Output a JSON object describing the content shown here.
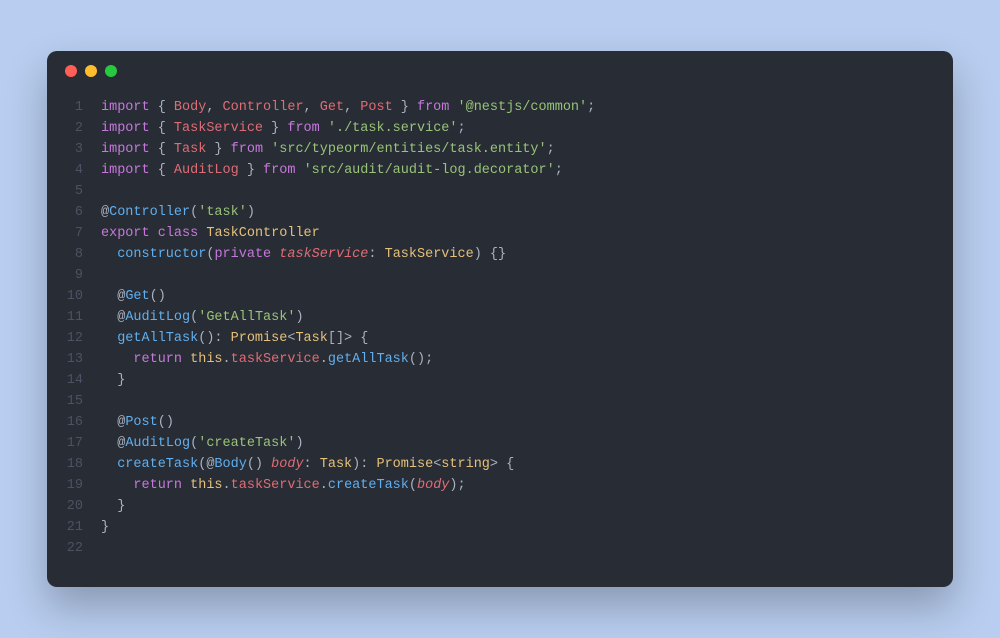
{
  "window": {
    "dot_red": "#ff5f56",
    "dot_yellow": "#ffbd2e",
    "dot_green": "#27c93f"
  },
  "lines": [
    {
      "no": "1",
      "tokens": [
        {
          "c": "tok-keyword",
          "t": "import"
        },
        {
          "c": "tok-punct",
          "t": " { "
        },
        {
          "c": "tok-var",
          "t": "Body"
        },
        {
          "c": "tok-punct",
          "t": ", "
        },
        {
          "c": "tok-var",
          "t": "Controller"
        },
        {
          "c": "tok-punct",
          "t": ", "
        },
        {
          "c": "tok-var",
          "t": "Get"
        },
        {
          "c": "tok-punct",
          "t": ", "
        },
        {
          "c": "tok-var",
          "t": "Post"
        },
        {
          "c": "tok-punct",
          "t": " } "
        },
        {
          "c": "tok-keyword",
          "t": "from"
        },
        {
          "c": "tok-punct",
          "t": " "
        },
        {
          "c": "tok-string",
          "t": "'@nestjs/common'"
        },
        {
          "c": "tok-punct",
          "t": ";"
        }
      ]
    },
    {
      "no": "2",
      "tokens": [
        {
          "c": "tok-keyword",
          "t": "import"
        },
        {
          "c": "tok-punct",
          "t": " { "
        },
        {
          "c": "tok-var",
          "t": "TaskService"
        },
        {
          "c": "tok-punct",
          "t": " } "
        },
        {
          "c": "tok-keyword",
          "t": "from"
        },
        {
          "c": "tok-punct",
          "t": " "
        },
        {
          "c": "tok-string",
          "t": "'./task.service'"
        },
        {
          "c": "tok-punct",
          "t": ";"
        }
      ]
    },
    {
      "no": "3",
      "tokens": [
        {
          "c": "tok-keyword",
          "t": "import"
        },
        {
          "c": "tok-punct",
          "t": " { "
        },
        {
          "c": "tok-var",
          "t": "Task"
        },
        {
          "c": "tok-punct",
          "t": " } "
        },
        {
          "c": "tok-keyword",
          "t": "from"
        },
        {
          "c": "tok-punct",
          "t": " "
        },
        {
          "c": "tok-string",
          "t": "'src/typeorm/entities/task.entity'"
        },
        {
          "c": "tok-punct",
          "t": ";"
        }
      ]
    },
    {
      "no": "4",
      "tokens": [
        {
          "c": "tok-keyword",
          "t": "import"
        },
        {
          "c": "tok-punct",
          "t": " { "
        },
        {
          "c": "tok-var",
          "t": "AuditLog"
        },
        {
          "c": "tok-punct",
          "t": " } "
        },
        {
          "c": "tok-keyword",
          "t": "from"
        },
        {
          "c": "tok-punct",
          "t": " "
        },
        {
          "c": "tok-string",
          "t": "'src/audit/audit-log.decorator'"
        },
        {
          "c": "tok-punct",
          "t": ";"
        }
      ]
    },
    {
      "no": "5",
      "tokens": []
    },
    {
      "no": "6",
      "tokens": [
        {
          "c": "tok-punct",
          "t": "@"
        },
        {
          "c": "tok-func",
          "t": "Controller"
        },
        {
          "c": "tok-punct",
          "t": "("
        },
        {
          "c": "tok-string",
          "t": "'task'"
        },
        {
          "c": "tok-punct",
          "t": ")"
        }
      ]
    },
    {
      "no": "7",
      "tokens": [
        {
          "c": "tok-keyword",
          "t": "export"
        },
        {
          "c": "tok-punct",
          "t": " "
        },
        {
          "c": "tok-keyword",
          "t": "class"
        },
        {
          "c": "tok-punct",
          "t": " "
        },
        {
          "c": "tok-class",
          "t": "TaskController"
        }
      ]
    },
    {
      "no": "8",
      "tokens": [
        {
          "c": "tok-punct",
          "t": "  "
        },
        {
          "c": "tok-func",
          "t": "constructor"
        },
        {
          "c": "tok-punct",
          "t": "("
        },
        {
          "c": "tok-keyword",
          "t": "private"
        },
        {
          "c": "tok-punct",
          "t": " "
        },
        {
          "c": "tok-varit",
          "t": "taskService"
        },
        {
          "c": "tok-punct",
          "t": ": "
        },
        {
          "c": "tok-class",
          "t": "TaskService"
        },
        {
          "c": "tok-punct",
          "t": ") {}"
        }
      ]
    },
    {
      "no": "9",
      "tokens": []
    },
    {
      "no": "10",
      "tokens": [
        {
          "c": "tok-punct",
          "t": "  @"
        },
        {
          "c": "tok-func",
          "t": "Get"
        },
        {
          "c": "tok-punct",
          "t": "()"
        }
      ]
    },
    {
      "no": "11",
      "tokens": [
        {
          "c": "tok-punct",
          "t": "  @"
        },
        {
          "c": "tok-func",
          "t": "AuditLog"
        },
        {
          "c": "tok-punct",
          "t": "("
        },
        {
          "c": "tok-string",
          "t": "'GetAllTask'"
        },
        {
          "c": "tok-punct",
          "t": ")"
        }
      ]
    },
    {
      "no": "12",
      "tokens": [
        {
          "c": "tok-punct",
          "t": "  "
        },
        {
          "c": "tok-func",
          "t": "getAllTask"
        },
        {
          "c": "tok-punct",
          "t": "(): "
        },
        {
          "c": "tok-class",
          "t": "Promise"
        },
        {
          "c": "tok-punct",
          "t": "<"
        },
        {
          "c": "tok-class",
          "t": "Task"
        },
        {
          "c": "tok-punct",
          "t": "[]> {"
        }
      ]
    },
    {
      "no": "13",
      "tokens": [
        {
          "c": "tok-punct",
          "t": "    "
        },
        {
          "c": "tok-keyword",
          "t": "return"
        },
        {
          "c": "tok-punct",
          "t": " "
        },
        {
          "c": "tok-this",
          "t": "this"
        },
        {
          "c": "tok-punct",
          "t": "."
        },
        {
          "c": "tok-prop",
          "t": "taskService"
        },
        {
          "c": "tok-punct",
          "t": "."
        },
        {
          "c": "tok-func",
          "t": "getAllTask"
        },
        {
          "c": "tok-punct",
          "t": "();"
        }
      ]
    },
    {
      "no": "14",
      "tokens": [
        {
          "c": "tok-punct",
          "t": "  }"
        }
      ]
    },
    {
      "no": "15",
      "tokens": []
    },
    {
      "no": "16",
      "tokens": [
        {
          "c": "tok-punct",
          "t": "  @"
        },
        {
          "c": "tok-func",
          "t": "Post"
        },
        {
          "c": "tok-punct",
          "t": "()"
        }
      ]
    },
    {
      "no": "17",
      "tokens": [
        {
          "c": "tok-punct",
          "t": "  @"
        },
        {
          "c": "tok-func",
          "t": "AuditLog"
        },
        {
          "c": "tok-punct",
          "t": "("
        },
        {
          "c": "tok-string",
          "t": "'createTask'"
        },
        {
          "c": "tok-punct",
          "t": ")"
        }
      ]
    },
    {
      "no": "18",
      "tokens": [
        {
          "c": "tok-punct",
          "t": "  "
        },
        {
          "c": "tok-func",
          "t": "createTask"
        },
        {
          "c": "tok-punct",
          "t": "(@"
        },
        {
          "c": "tok-func",
          "t": "Body"
        },
        {
          "c": "tok-punct",
          "t": "() "
        },
        {
          "c": "tok-varit",
          "t": "body"
        },
        {
          "c": "tok-punct",
          "t": ": "
        },
        {
          "c": "tok-class",
          "t": "Task"
        },
        {
          "c": "tok-punct",
          "t": "): "
        },
        {
          "c": "tok-class",
          "t": "Promise"
        },
        {
          "c": "tok-punct",
          "t": "<"
        },
        {
          "c": "tok-class",
          "t": "string"
        },
        {
          "c": "tok-punct",
          "t": "> {"
        }
      ]
    },
    {
      "no": "19",
      "tokens": [
        {
          "c": "tok-punct",
          "t": "    "
        },
        {
          "c": "tok-keyword",
          "t": "return"
        },
        {
          "c": "tok-punct",
          "t": " "
        },
        {
          "c": "tok-this",
          "t": "this"
        },
        {
          "c": "tok-punct",
          "t": "."
        },
        {
          "c": "tok-prop",
          "t": "taskService"
        },
        {
          "c": "tok-punct",
          "t": "."
        },
        {
          "c": "tok-func",
          "t": "createTask"
        },
        {
          "c": "tok-punct",
          "t": "("
        },
        {
          "c": "tok-varit",
          "t": "body"
        },
        {
          "c": "tok-punct",
          "t": ");"
        }
      ]
    },
    {
      "no": "20",
      "tokens": [
        {
          "c": "tok-punct",
          "t": "  }"
        }
      ]
    },
    {
      "no": "21",
      "tokens": [
        {
          "c": "tok-punct",
          "t": "}"
        }
      ]
    },
    {
      "no": "22",
      "tokens": []
    }
  ]
}
